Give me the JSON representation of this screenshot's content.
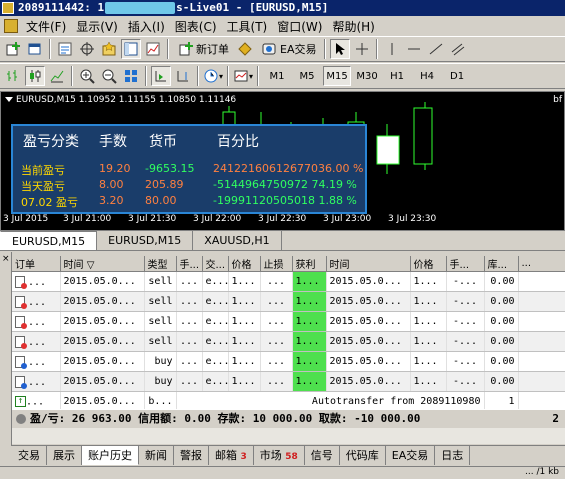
{
  "window": {
    "title_prefix": "2089111442: 1",
    "title_suffix": "s-Live01 - [EURUSD,M15]"
  },
  "menu": [
    "文件(F)",
    "显示(V)",
    "插入(I)",
    "图表(C)",
    "工具(T)",
    "窗口(W)",
    "帮助(H)"
  ],
  "toolbar1": {
    "new_order": "新订单",
    "ea_trading": "EA交易"
  },
  "timeframes": [
    "M1",
    "M5",
    "M15",
    "M30",
    "H1",
    "H4",
    "D1"
  ],
  "active_timeframe": "M15",
  "chart": {
    "header": "EURUSD,M15  1.10952 1.11155 1.10850 1.11146",
    "corner": "bf",
    "time_labels": [
      "3 Jul 2015",
      "3 Jul 21:00",
      "3 Jul 21:30",
      "3 Jul 22:00",
      "3 Jul 22:30",
      "3 Jul 23:00",
      "3 Jul 23:30"
    ]
  },
  "panel": {
    "headers": [
      "盈亏分类",
      "手数",
      "货币",
      "百分比"
    ],
    "rows": [
      {
        "label": "当前盈亏",
        "lots": "19.20",
        "amount": "-9653.15",
        "percent": "24122160612677036.00 %"
      },
      {
        "label": "当天盈亏",
        "lots": "8.00",
        "amount": "205.89",
        "percent": "-5144964750972 74.19 %"
      },
      {
        "label": "07.02 盈亏",
        "lots": "3.20",
        "amount": "80.00",
        "percent": "-19991120505018 1.88 %"
      }
    ]
  },
  "chart_tabs": [
    "EURUSD,M15",
    "EURUSD,M15",
    "XAUUSD,H1"
  ],
  "orders": {
    "columns": [
      "订单",
      "时间",
      "类型",
      "手...",
      "交...",
      "价格",
      "止损",
      "获利",
      "时间",
      "价格",
      "手...",
      "库...",
      "..."
    ],
    "rows": [
      {
        "ticket": "...",
        "time": "2015.05.0...",
        "type": "sell",
        "lots": "...",
        "symbol": "e...",
        "price": "1...",
        "sl": "...",
        "tp": "1...",
        "close_time": "2015.05.0...",
        "close_price": "1...",
        "comm": "-...",
        "swap": "0.00",
        "side": "sell"
      },
      {
        "ticket": "...",
        "time": "2015.05.0...",
        "type": "sell",
        "lots": "...",
        "symbol": "e...",
        "price": "1...",
        "sl": "...",
        "tp": "1...",
        "close_time": "2015.05.0...",
        "close_price": "1...",
        "comm": "-...",
        "swap": "0.00",
        "side": "sell"
      },
      {
        "ticket": "...",
        "time": "2015.05.0...",
        "type": "sell",
        "lots": "...",
        "symbol": "e...",
        "price": "1...",
        "sl": "...",
        "tp": "1...",
        "close_time": "2015.05.0...",
        "close_price": "1...",
        "comm": "-...",
        "swap": "0.00",
        "side": "sell"
      },
      {
        "ticket": "...",
        "time": "2015.05.0...",
        "type": "sell",
        "lots": "...",
        "symbol": "e...",
        "price": "1...",
        "sl": "...",
        "tp": "1...",
        "close_time": "2015.05.0...",
        "close_price": "1...",
        "comm": "-...",
        "swap": "0.00",
        "side": "sell"
      },
      {
        "ticket": "...",
        "time": "2015.05.0...",
        "type": "buy",
        "lots": "...",
        "symbol": "e...",
        "price": "1...",
        "sl": "...",
        "tp": "1...",
        "close_time": "2015.05.0...",
        "close_price": "1...",
        "comm": "-...",
        "swap": "0.00",
        "side": "buy"
      },
      {
        "ticket": "...",
        "time": "2015.05.0...",
        "type": "buy",
        "lots": "...",
        "symbol": "e...",
        "price": "1...",
        "sl": "...",
        "tp": "1...",
        "close_time": "2015.05.0...",
        "close_price": "1...",
        "comm": "-...",
        "swap": "0.00",
        "side": "buy"
      }
    ],
    "transfer": {
      "ticket": "...",
      "time": "2015.05.0...",
      "type": "b...",
      "text": "Autotransfer from 2089110980",
      "value": "1"
    }
  },
  "summary": "盈/亏: 26 963.00  信用额: 0.00  存款: 10 000.00  取款: -10 000.00",
  "summary_right": "2",
  "bottom_tabs": [
    {
      "label": "交易"
    },
    {
      "label": "展示"
    },
    {
      "label": "账户历史"
    },
    {
      "label": "新闻"
    },
    {
      "label": "警报"
    },
    {
      "label": "邮箱",
      "count": "3"
    },
    {
      "label": "市场",
      "count": "58"
    },
    {
      "label": "信号"
    },
    {
      "label": "代码库"
    },
    {
      "label": "EA交易"
    },
    {
      "label": "日志"
    }
  ],
  "active_bottom_tab": "账户历史",
  "status": {
    "net": "... /1 kb"
  }
}
